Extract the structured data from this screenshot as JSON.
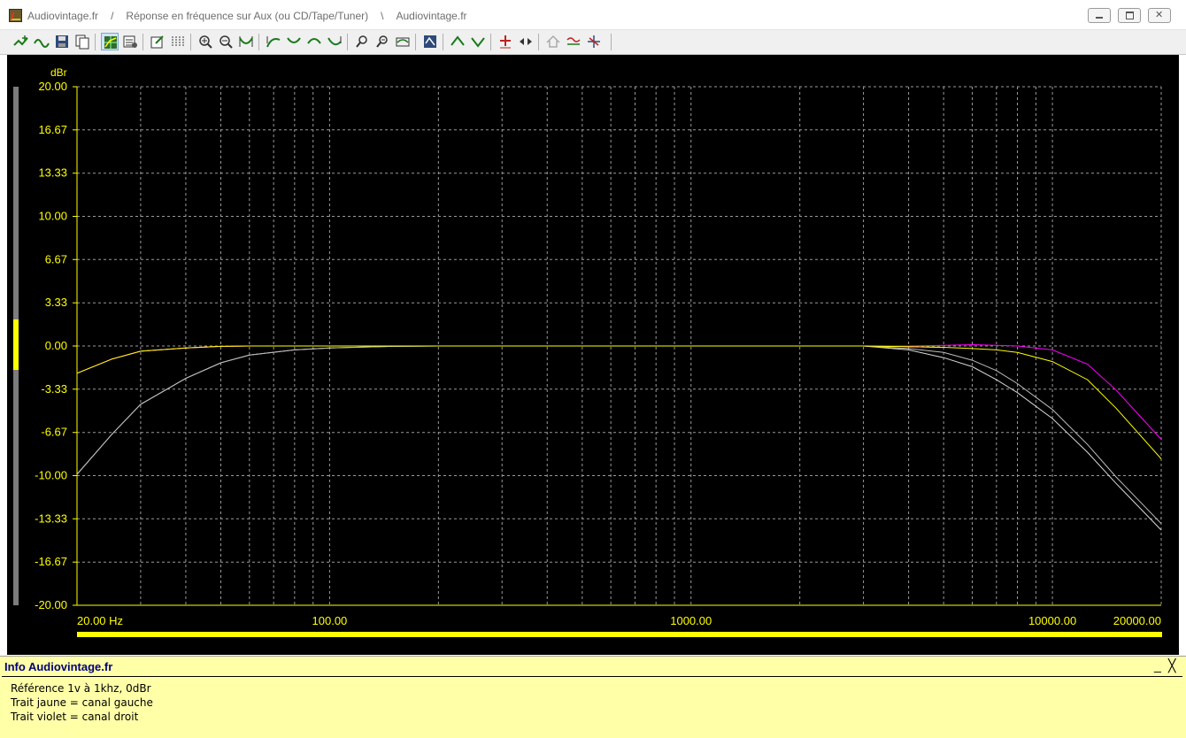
{
  "window": {
    "title_parts": [
      "Audiovintage.fr",
      "/",
      "Réponse en fréquence sur Aux (ou CD/Tape/Tuner)",
      "\\",
      "Audiovintage.fr"
    ]
  },
  "toolbar": {
    "icons": [
      "add-trace-icon",
      "waveform-icon",
      "save-icon",
      "copy-icon",
      "grid-view-icon",
      "settings-grid-icon",
      "edit-icon",
      "data-table-icon",
      "zoom-in-icon",
      "zoom-out-icon",
      "fit-curve-icon",
      "curve-up-icon",
      "curve-down-icon",
      "curve-shift-left-icon",
      "curve-shift-right-icon",
      "zoom-x-icon",
      "zoom-y-icon",
      "sweep-icon",
      "auto-scale-icon",
      "peak-icon",
      "notch-icon",
      "add-marker-icon",
      "marker-toggle-icon",
      "home-icon",
      "filter-icon",
      "axis-settings-icon"
    ]
  },
  "chart_data": {
    "type": "line",
    "y_unit_label": "dBr",
    "x_scale": "log",
    "xlim": [
      20,
      20000
    ],
    "ylim": [
      -20,
      20
    ],
    "y_ticks": [
      "20.00",
      "16.67",
      "13.33",
      "10.00",
      "6.67",
      "3.33",
      "0.00",
      "-3.33",
      "-6.67",
      "-10.00",
      "-13.33",
      "-16.67",
      "-20.00"
    ],
    "x_tick_labels": [
      {
        "value": 20,
        "label": "20.00 Hz"
      },
      {
        "value": 100,
        "label": "100.00"
      },
      {
        "value": 1000,
        "label": "1000.00"
      },
      {
        "value": 10000,
        "label": "10000.00"
      },
      {
        "value": 20000,
        "label": "20000.00"
      }
    ],
    "grid": true,
    "background": "#000000",
    "grid_color": "#9a9a9a",
    "tick_color": "#ffff00",
    "series": [
      {
        "color": "#ffff00",
        "x": [
          20,
          25,
          30,
          40,
          50,
          60,
          80,
          100,
          150,
          200,
          300,
          500,
          1000,
          2000,
          3000,
          4000,
          5000,
          6000,
          7000,
          8000,
          10000,
          12500,
          15000,
          20000
        ],
        "y": [
          -2.1,
          -1.0,
          -0.4,
          -0.15,
          -0.03,
          0,
          0,
          0,
          0,
          0,
          0,
          0,
          0,
          0,
          0,
          -0.05,
          -0.1,
          -0.2,
          -0.3,
          -0.5,
          -1.2,
          -2.6,
          -4.8,
          -8.7
        ]
      },
      {
        "color": "#ff00ff",
        "x": [
          20,
          25,
          30,
          40,
          50,
          60,
          80,
          100,
          150,
          200,
          300,
          500,
          1000,
          2000,
          3000,
          4000,
          5000,
          6000,
          7000,
          8000,
          10000,
          12500,
          15000,
          20000
        ],
        "y": [
          -2.1,
          -1.0,
          -0.4,
          -0.15,
          -0.03,
          0,
          0,
          0,
          0,
          0,
          0,
          0,
          0,
          0,
          0,
          0,
          0.05,
          0.1,
          0.05,
          0,
          -0.3,
          -1.4,
          -3.4,
          -7.2
        ]
      },
      {
        "color": "#d8d8d8",
        "x": [
          20,
          25,
          30,
          40,
          50,
          60,
          80,
          100,
          150,
          200,
          300,
          500,
          1000,
          2000,
          3000,
          4000,
          5000,
          6000,
          7000,
          8000,
          10000,
          12500,
          15000,
          20000
        ],
        "y": [
          -9.9,
          -6.8,
          -4.5,
          -2.5,
          -1.3,
          -0.7,
          -0.3,
          -0.15,
          -0.03,
          0,
          0,
          0,
          0,
          0,
          0,
          -0.3,
          -0.9,
          -1.6,
          -2.6,
          -3.6,
          -5.6,
          -8.2,
          -10.6,
          -14.2
        ]
      },
      {
        "color": "#bdbdbd",
        "x": [
          20,
          25,
          30,
          40,
          50,
          60,
          80,
          100,
          150,
          200,
          300,
          500,
          1000,
          2000,
          3000,
          4000,
          5000,
          6000,
          7000,
          8000,
          10000,
          12500,
          15000,
          20000
        ],
        "y": [
          -9.9,
          -6.8,
          -4.5,
          -2.5,
          -1.3,
          -0.7,
          -0.3,
          -0.15,
          -0.03,
          0,
          0,
          0,
          0,
          0,
          0,
          -0.2,
          -0.5,
          -1.1,
          -1.9,
          -2.9,
          -4.9,
          -7.6,
          -10.1,
          -13.7
        ]
      }
    ]
  },
  "info": {
    "title": "Info Audiovintage.fr",
    "min_label": "_",
    "close_label": "╳",
    "lines": [
      "Référence 1v à 1khz, 0dBr",
      "Trait jaune = canal gauche",
      "Trait violet = canal droit"
    ]
  }
}
